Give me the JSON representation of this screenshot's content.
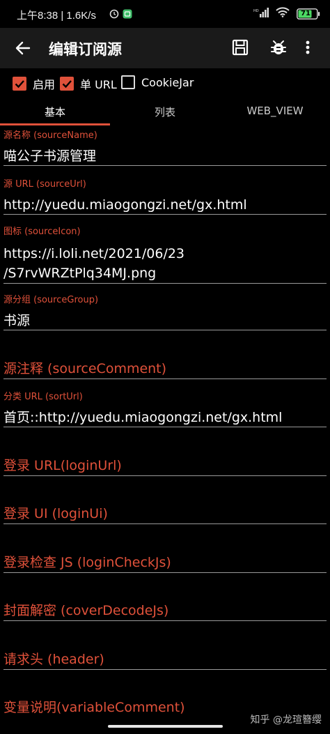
{
  "status_bar": {
    "time_speed": "上午8:38 | 1.6K/s",
    "battery": "71"
  },
  "app_bar": {
    "title": "编辑订阅源",
    "back_icon": "arrow-back-icon",
    "save_icon": "save-icon",
    "debug_icon": "bug-icon",
    "more_icon": "more-vert-icon"
  },
  "options": [
    {
      "label": "启用",
      "checked": true
    },
    {
      "label": "单 URL",
      "checked": true
    },
    {
      "label": "CookieJar",
      "checked": false
    }
  ],
  "tabs": [
    {
      "label": "基本",
      "active": true
    },
    {
      "label": "列表",
      "active": false
    },
    {
      "label": "WEB_VIEW",
      "active": false
    }
  ],
  "fields": {
    "source_name": {
      "label": "源名称 (sourceName)",
      "value": "喵公子书源管理"
    },
    "source_url": {
      "label": "源 URL (sourceUrl)",
      "value": "http://yuedu.miaogongzi.net/gx.html"
    },
    "source_icon": {
      "label": "图标 (sourceIcon)",
      "value_line1": "https://i.loli.net/2021/06/23",
      "value_line2": "/S7rvWRZtPlq34MJ.png"
    },
    "source_group": {
      "label": "源分组 (sourceGroup)",
      "value": "书源"
    },
    "source_comment": {
      "placeholder": "源注释 (sourceComment)"
    },
    "sort_url": {
      "label": "分类 URL (sortUrl)",
      "value": "首页::http://yuedu.miaogongzi.net/gx.html"
    },
    "login_url": {
      "placeholder": "登录 URL(loginUrl)"
    },
    "login_ui": {
      "placeholder": "登录 UI (loginUi)"
    },
    "login_check_js": {
      "placeholder": "登录检查 JS (loginCheckJs)"
    },
    "cover_decode_js": {
      "placeholder": "封面解密 (coverDecodeJs)"
    },
    "header": {
      "placeholder": "请求头 (header)"
    },
    "variable_comment": {
      "placeholder": "变量说明(variableComment)"
    }
  },
  "watermark": "知乎 @龙瑄簪缨",
  "colors": {
    "accent": "#e0513a",
    "background": "#000000",
    "app_bar": "#1a1a1a"
  }
}
